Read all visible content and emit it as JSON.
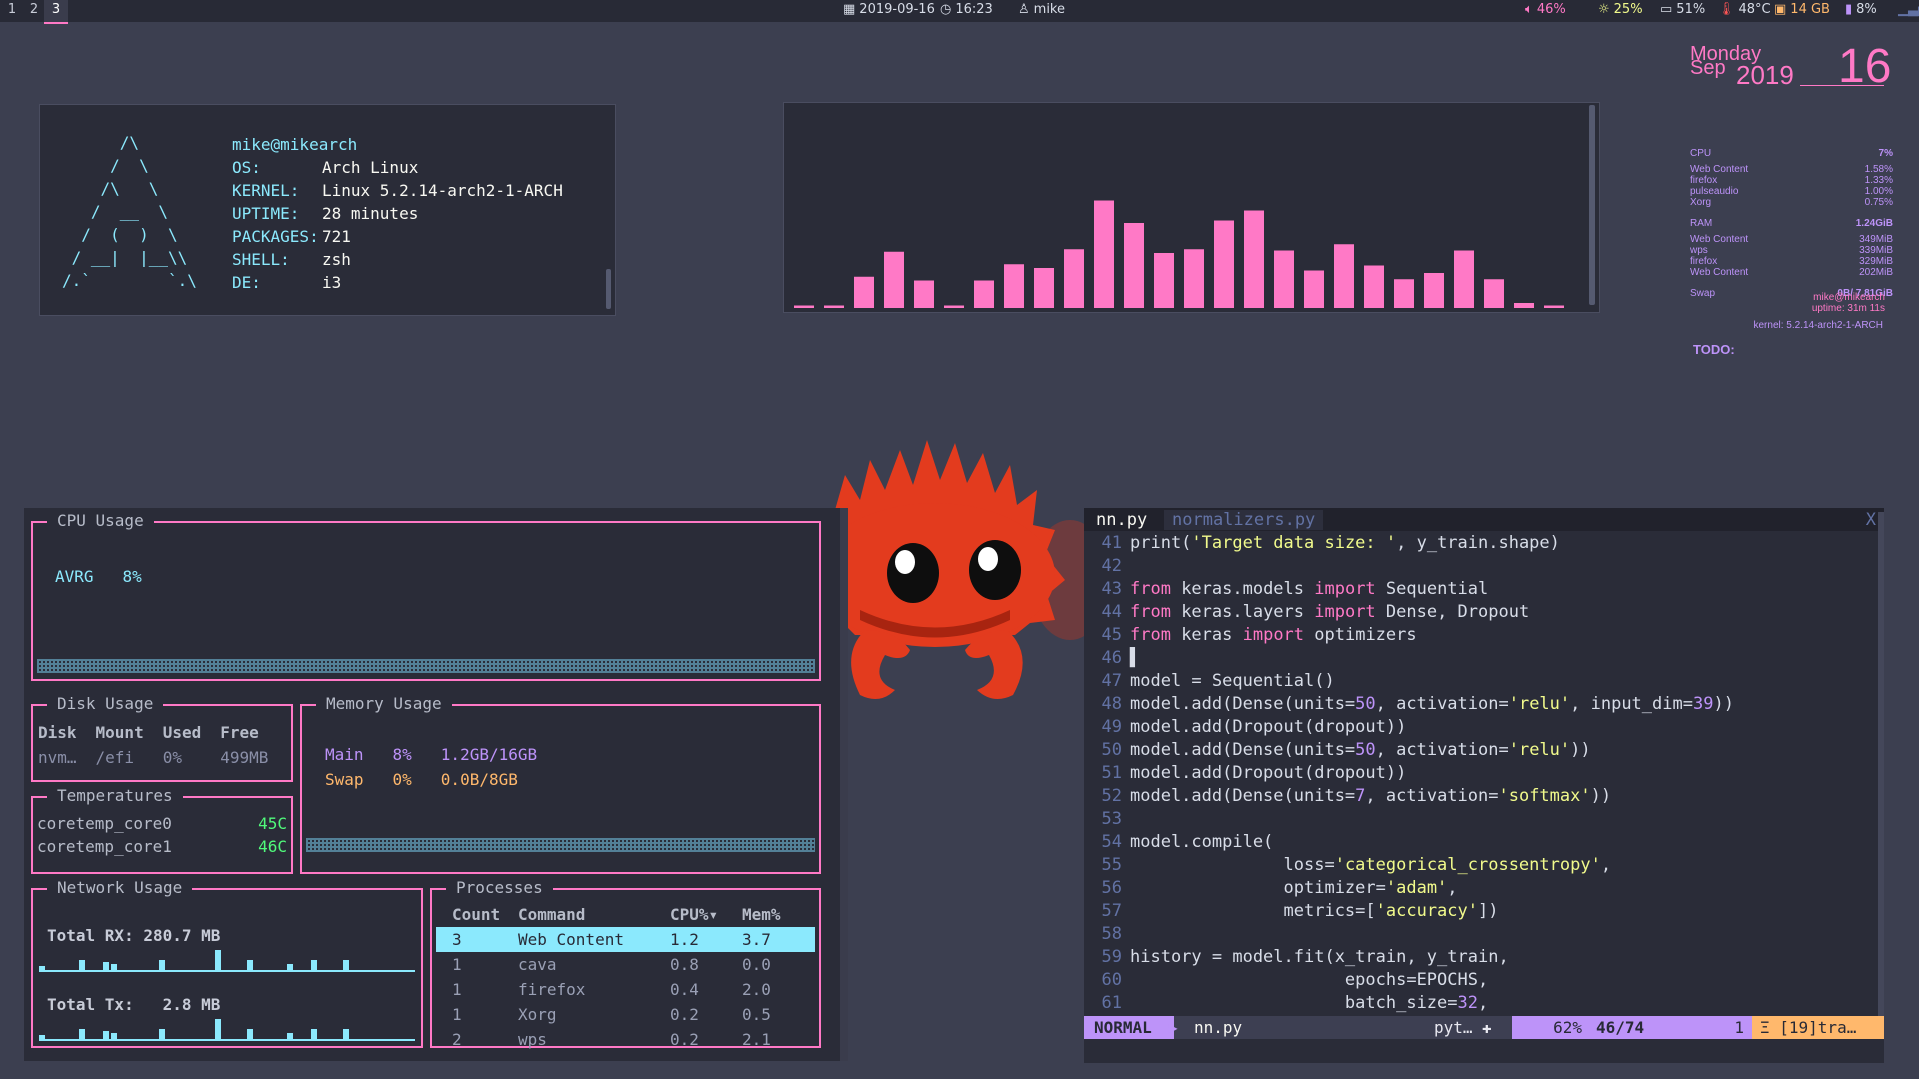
{
  "topbar": {
    "workspaces": [
      "1",
      "2",
      "3"
    ],
    "date": "2019-09-16",
    "time": "16:23",
    "user": "mike",
    "volume": "46%",
    "brightness": "25%",
    "cpu_temp_label": "51%",
    "temperature": "48°C",
    "storage": "14 GB",
    "battery": "8%",
    "colors": {
      "accent": "#ff79c6",
      "bar_bg": "#282a36"
    }
  },
  "neofetch": {
    "logo": [
      "      /\\",
      "     /  \\",
      "    /\\   \\",
      "   /  __  \\",
      "  /  (  )  \\",
      " / __|  |__\\\\",
      "/.`        `.\\"
    ],
    "user_host": "mike@mikearch",
    "rows": [
      {
        "key": "OS:",
        "value": "Arch Linux"
      },
      {
        "key": "KERNEL:",
        "value": "Linux 5.2.14-arch2-1-ARCH"
      },
      {
        "key": "UPTIME:",
        "value": "28 minutes"
      },
      {
        "key": "PACKAGES:",
        "value": "721"
      },
      {
        "key": "SHELL:",
        "value": "zsh"
      },
      {
        "key": "DE:",
        "value": "i3"
      }
    ]
  },
  "chart_data": {
    "type": "bar",
    "title": "",
    "values": [
      2,
      2,
      25,
      45,
      22,
      2,
      22,
      35,
      32,
      47,
      86,
      68,
      44,
      47,
      70,
      78,
      46,
      30,
      51,
      34,
      23,
      28,
      46,
      23,
      4,
      2
    ],
    "ylim": [
      0,
      100
    ],
    "color": "#ff79c6"
  },
  "widget": {
    "month_day": "Monday",
    "month": "Sep",
    "year": "2019",
    "day": "16",
    "cpu_label": "CPU",
    "cpu_value": "7%",
    "cpu_procs": [
      {
        "name": "Web Content",
        "value": "1.58%"
      },
      {
        "name": "firefox",
        "value": "1.33%"
      },
      {
        "name": "pulseaudio",
        "value": "1.00%"
      },
      {
        "name": "Xorg",
        "value": "0.75%"
      }
    ],
    "ram_label": "RAM",
    "ram_value": "1.24GiB",
    "ram_procs": [
      {
        "name": "Web Content",
        "value": "349MiB"
      },
      {
        "name": "wps",
        "value": "339MiB"
      },
      {
        "name": "firefox",
        "value": "329MiB"
      },
      {
        "name": "Web Content",
        "value": "202MiB"
      }
    ],
    "swap_label": "Swap",
    "swap_value": "0B/ 7.81GiB",
    "user_host": "mike@mikearch",
    "uptime": "uptime: 31m 11s",
    "kernel": "kernel: 5.2.14-arch2-1-ARCH",
    "todo": "TODO:"
  },
  "gtop": {
    "cpu_title": "CPU Usage",
    "cpu_avg_label": "AVRG",
    "cpu_avg_value": "8%",
    "disk_title": "Disk Usage",
    "disk_headers": [
      "Disk",
      "Mount",
      "Used",
      "Free"
    ],
    "disk_row": [
      "nvm…",
      "/efi",
      "0%",
      "499MB"
    ],
    "mem_title": "Memory Usage",
    "mem_rows": [
      {
        "label": "Main",
        "pct": "8%",
        "value": "1.2GB/16GB"
      },
      {
        "label": "Swap",
        "pct": "0%",
        "value": "0.0B/8GB"
      }
    ],
    "temp_title": "Temperatures",
    "temps": [
      {
        "name": "coretemp_core0",
        "value": "45C"
      },
      {
        "name": "coretemp_core1",
        "value": "46C"
      }
    ],
    "net_title": "Network Usage",
    "net_rx": "Total RX: 280.7 MB",
    "net_tx": "Total Tx:   2.8 MB",
    "proc_title": "Processes",
    "proc_headers": [
      "Count",
      "Command",
      "CPU%▾",
      "Mem%"
    ],
    "procs": [
      [
        "3",
        "Web Content",
        "1.2",
        "3.7"
      ],
      [
        "1",
        "cava",
        "0.8",
        "0.0"
      ],
      [
        "1",
        "firefox",
        "0.4",
        "2.0"
      ],
      [
        "1",
        "Xorg",
        "0.2",
        "0.5"
      ],
      [
        "2",
        "wps",
        "0.2",
        "2.1"
      ]
    ]
  },
  "editor": {
    "tabs": [
      {
        "label": "nn.py"
      },
      {
        "label": "normalizers.py"
      }
    ],
    "close": "X",
    "lines": [
      {
        "n": "41",
        "html": "print(<s>'Target data size: '</s>, y_train.shape)"
      },
      {
        "n": "42",
        "html": ""
      },
      {
        "n": "43",
        "html": "<k>from</k> keras.models <k>import</k> Sequential"
      },
      {
        "n": "44",
        "html": "<k>from</k> keras.layers <k>import</k> Dense, Dropout"
      },
      {
        "n": "45",
        "html": "<k>from</k> keras <k>import</k> optimizers"
      },
      {
        "n": "46",
        "html": "▌"
      },
      {
        "n": "47",
        "html": "model = Sequential()"
      },
      {
        "n": "48",
        "html": "model.add(Dense(units=<n>50</n>, activation=<s>'relu'</s>, input_dim=<n>39</n>))"
      },
      {
        "n": "49",
        "html": "model.add(Dropout(dropout))"
      },
      {
        "n": "50",
        "html": "model.add(Dense(units=<n>50</n>, activation=<s>'relu'</s>))"
      },
      {
        "n": "51",
        "html": "model.add(Dropout(dropout))"
      },
      {
        "n": "52",
        "html": "model.add(Dense(units=<n>7</n>, activation=<s>'softmax'</s>))"
      },
      {
        "n": "53",
        "html": ""
      },
      {
        "n": "54",
        "html": "model.compile("
      },
      {
        "n": "55",
        "html": "               loss=<s>'categorical_crossentropy'</s>,"
      },
      {
        "n": "56",
        "html": "               optimizer=<s>'adam'</s>,"
      },
      {
        "n": "57",
        "html": "               metrics=[<s>'accuracy'</s>])"
      },
      {
        "n": "58",
        "html": ""
      },
      {
        "n": "59",
        "html": "history = model.fit(x_train, y_train,"
      },
      {
        "n": "60",
        "html": "                     epochs=EPOCHS,"
      },
      {
        "n": "61",
        "html": "                     batch_size=<n>32</n>,"
      }
    ],
    "status": {
      "mode": "NORMAL",
      "file": "nn.py",
      "filetype": "pyt…",
      "percent": "62%",
      "position": "46/74",
      "col": "1",
      "warnings": "Ξ [19]tra…"
    }
  }
}
